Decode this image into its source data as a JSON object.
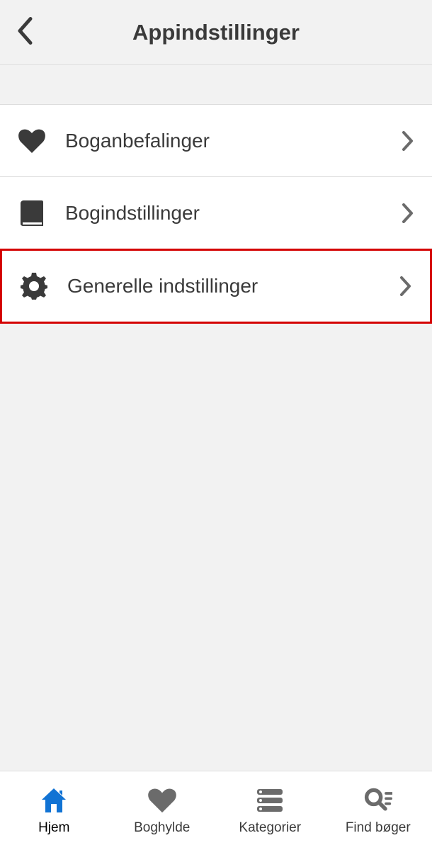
{
  "header": {
    "title": "Appindstillinger"
  },
  "items": [
    {
      "label": "Boganbefalinger",
      "icon": "heart"
    },
    {
      "label": "Bogindstillinger",
      "icon": "book"
    },
    {
      "label": "Generelle indstillinger",
      "icon": "gear",
      "highlighted": true
    }
  ],
  "nav": [
    {
      "label": "Hjem",
      "icon": "home",
      "active": true
    },
    {
      "label": "Boghylde",
      "icon": "heart"
    },
    {
      "label": "Kategorier",
      "icon": "list"
    },
    {
      "label": "Find bøger",
      "icon": "search"
    }
  ],
  "colors": {
    "active": "#1173d4",
    "inactive": "#6b6b6b",
    "text": "#3a3a3a",
    "highlight": "#d40000"
  }
}
